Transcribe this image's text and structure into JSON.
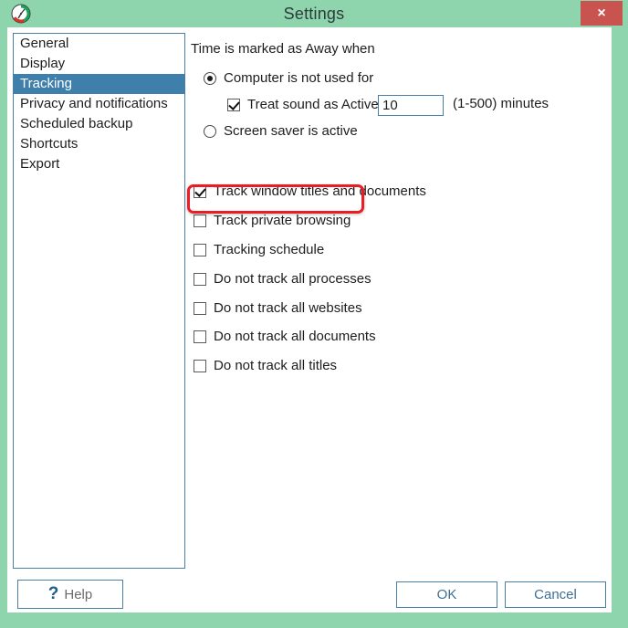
{
  "window": {
    "title": "Settings",
    "app_icon": "clock-icon",
    "close_label": "×",
    "accent_green": "#8ed5ae",
    "close_red": "#c9544f",
    "selection_blue": "#3e80ab",
    "highlight_red": "#ec1c24"
  },
  "sidebar": {
    "items": [
      {
        "label": "General",
        "selected": false
      },
      {
        "label": "Display",
        "selected": false
      },
      {
        "label": "Tracking",
        "selected": true
      },
      {
        "label": "Privacy and notifications",
        "selected": false
      },
      {
        "label": "Scheduled backup",
        "selected": false
      },
      {
        "label": "Shortcuts",
        "selected": false
      },
      {
        "label": "Export",
        "selected": false
      }
    ]
  },
  "content": {
    "group_label": "Time is marked as Away when",
    "radios": [
      {
        "label": "Computer is not used for",
        "checked": true
      },
      {
        "label": "Screen saver is active",
        "checked": false
      }
    ],
    "sound_checkbox": {
      "label": "Treat sound as Active",
      "checked": true
    },
    "minutes_input": {
      "value": "10",
      "placeholder": ""
    },
    "minutes_hint": "(1-500) minutes",
    "checkboxes": [
      {
        "label": "Track window titles and documents",
        "checked": true,
        "highlighted": false
      },
      {
        "label": "Track private browsing",
        "checked": false,
        "highlighted": true
      },
      {
        "label": "Tracking schedule",
        "checked": false,
        "highlighted": false
      },
      {
        "label": "Do not track all processes",
        "checked": false,
        "highlighted": false
      },
      {
        "label": "Do not track all websites",
        "checked": false,
        "highlighted": false
      },
      {
        "label": "Do not track all documents",
        "checked": false,
        "highlighted": false
      },
      {
        "label": "Do not track all titles",
        "checked": false,
        "highlighted": false
      }
    ]
  },
  "footer": {
    "help_icon": "question-mark-icon",
    "help_label": "Help",
    "ok_label": "OK",
    "cancel_label": "Cancel"
  }
}
